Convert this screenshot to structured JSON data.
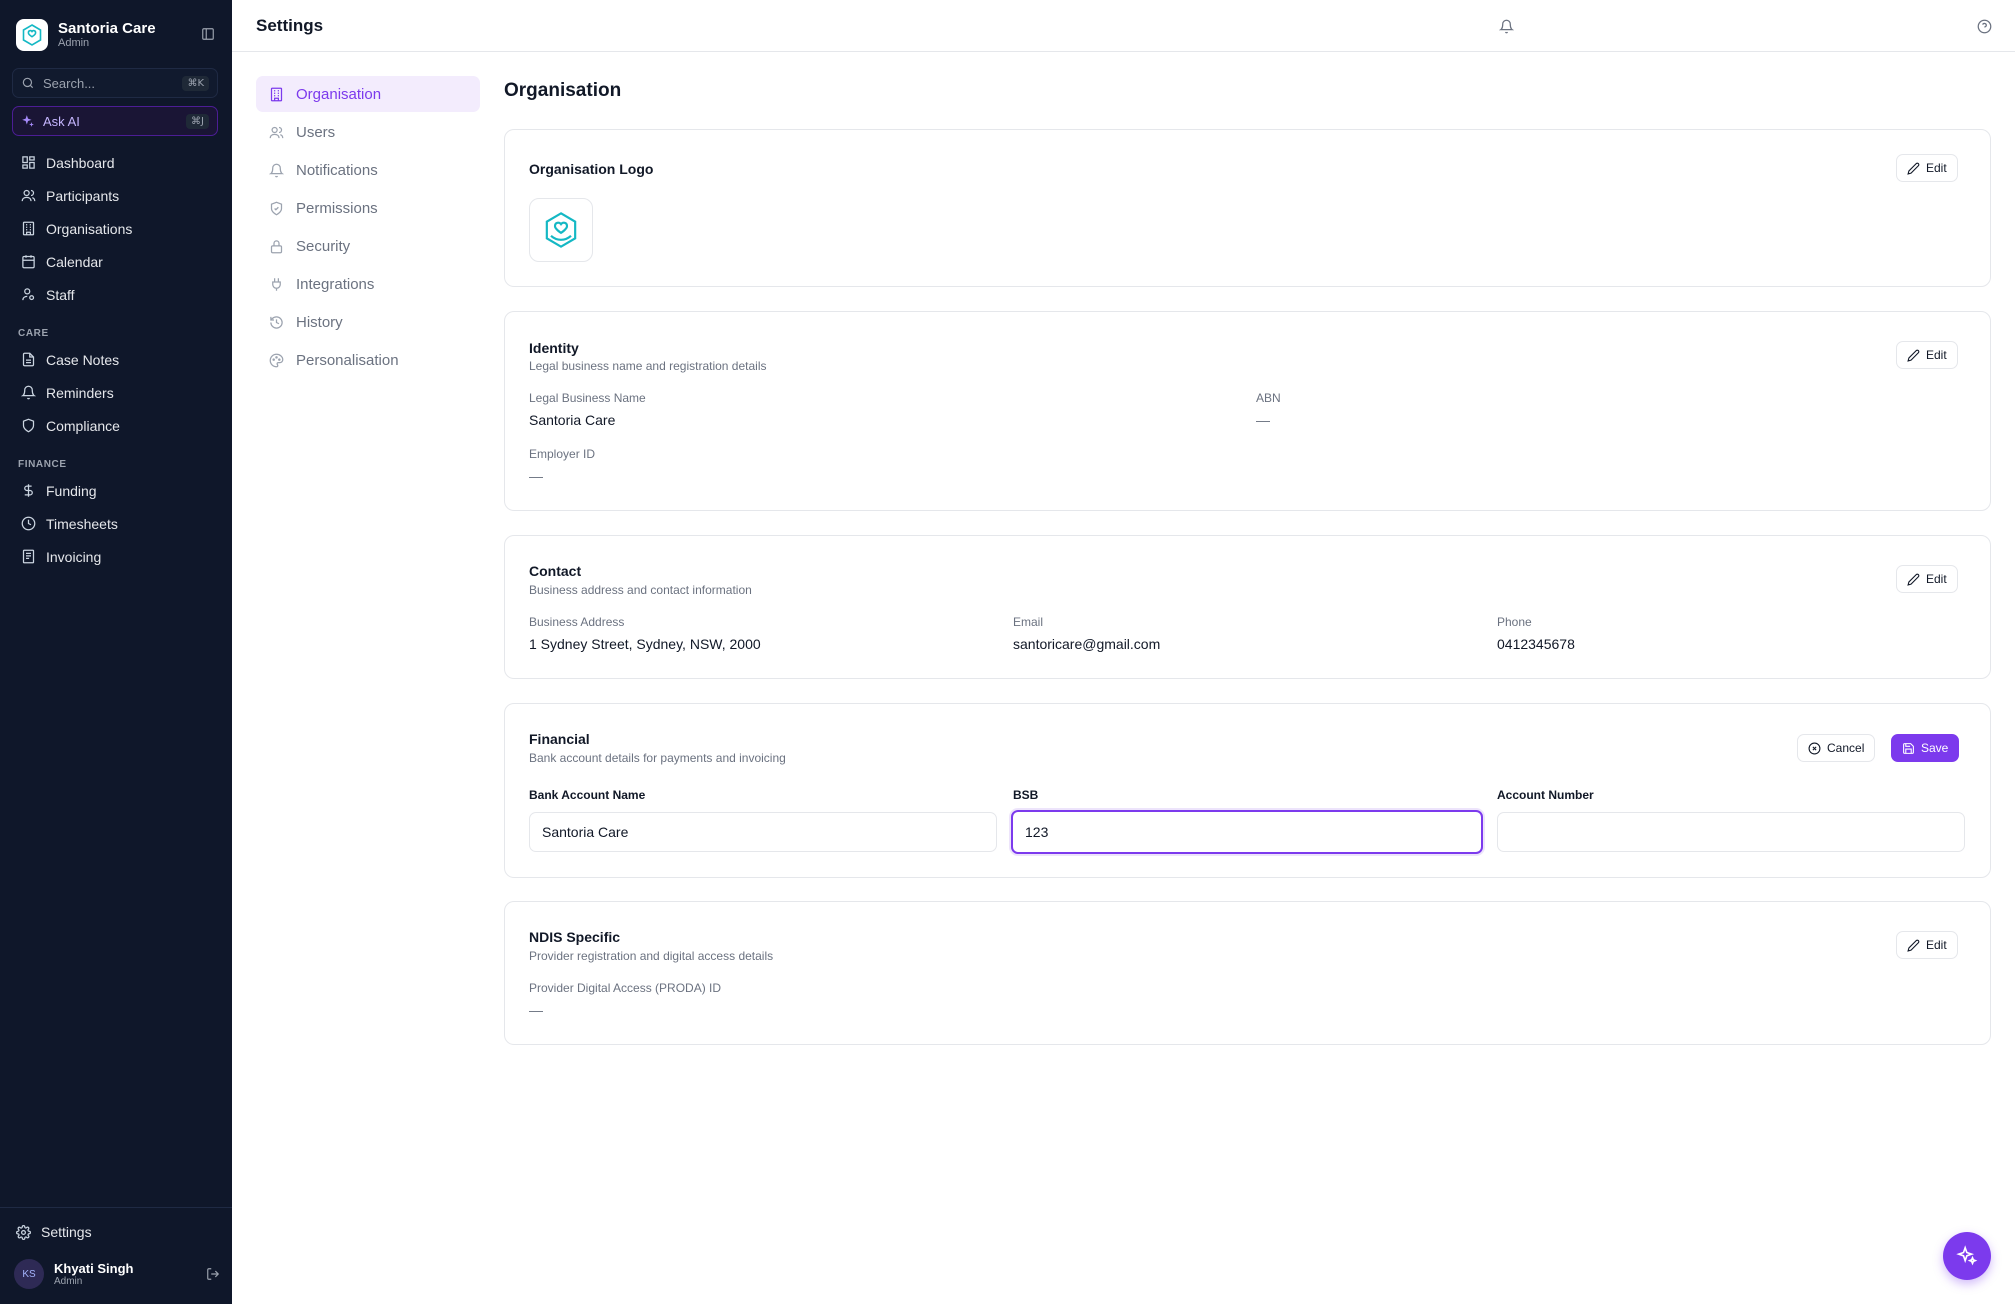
{
  "brand": {
    "name": "Santoria Care",
    "role": "Admin"
  },
  "search": {
    "placeholder": "Search...",
    "shortcut": "⌘K"
  },
  "ask_ai": {
    "label": "Ask AI",
    "shortcut": "⌘J"
  },
  "nav": {
    "main": [
      {
        "label": "Dashboard",
        "icon": "dashboard-icon"
      },
      {
        "label": "Participants",
        "icon": "users-icon"
      },
      {
        "label": "Organisations",
        "icon": "building-icon"
      },
      {
        "label": "Calendar",
        "icon": "calendar-icon"
      },
      {
        "label": "Staff",
        "icon": "staff-icon"
      }
    ],
    "care_title": "CARE",
    "care": [
      {
        "label": "Case Notes",
        "icon": "notes-icon"
      },
      {
        "label": "Reminders",
        "icon": "bell-icon"
      },
      {
        "label": "Compliance",
        "icon": "shield-icon"
      }
    ],
    "finance_title": "FINANCE",
    "finance": [
      {
        "label": "Funding",
        "icon": "dollar-icon"
      },
      {
        "label": "Timesheets",
        "icon": "clock-icon"
      },
      {
        "label": "Invoicing",
        "icon": "invoice-icon"
      }
    ],
    "settings_label": "Settings"
  },
  "user": {
    "initials": "KS",
    "name": "Khyati Singh",
    "role": "Admin"
  },
  "topbar": {
    "title": "Settings"
  },
  "settings_menu": [
    {
      "label": "Organisation",
      "icon": "building-icon",
      "active": true
    },
    {
      "label": "Users",
      "icon": "users-icon"
    },
    {
      "label": "Notifications",
      "icon": "bell-icon"
    },
    {
      "label": "Permissions",
      "icon": "shield-check-icon"
    },
    {
      "label": "Security",
      "icon": "lock-icon"
    },
    {
      "label": "Integrations",
      "icon": "plug-icon"
    },
    {
      "label": "History",
      "icon": "history-icon"
    },
    {
      "label": "Personalisation",
      "icon": "palette-icon"
    }
  ],
  "main": {
    "title": "Organisation",
    "logo_card": {
      "title": "Organisation Logo",
      "edit_label": "Edit"
    },
    "identity": {
      "title": "Identity",
      "subtitle": "Legal business name and registration details",
      "edit_label": "Edit",
      "legal_name_label": "Legal Business Name",
      "legal_name_value": "Santoria Care",
      "abn_label": "ABN",
      "abn_value": "—",
      "employer_label": "Employer ID",
      "employer_value": "—"
    },
    "contact": {
      "title": "Contact",
      "subtitle": "Business address and contact information",
      "edit_label": "Edit",
      "address_label": "Business Address",
      "address_value": "1 Sydney Street, Sydney, NSW, 2000",
      "email_label": "Email",
      "email_value": "santoricare@gmail.com",
      "phone_label": "Phone",
      "phone_value": "0412345678"
    },
    "financial": {
      "title": "Financial",
      "subtitle": "Bank account details for payments and invoicing",
      "cancel_label": "Cancel",
      "save_label": "Save",
      "bank_name_label": "Bank Account Name",
      "bank_name_value": "Santoria Care",
      "bsb_label": "BSB",
      "bsb_value": "123",
      "account_label": "Account Number",
      "account_value": ""
    },
    "ndis": {
      "title": "NDIS Specific",
      "subtitle": "Provider registration and digital access details",
      "edit_label": "Edit",
      "proda_label": "Provider Digital Access (PRODA) ID",
      "proda_value": "—"
    }
  },
  "colors": {
    "accent": "#7c3aed",
    "sidebar_bg": "#0f172a",
    "brand_teal": "#14b8c4"
  }
}
